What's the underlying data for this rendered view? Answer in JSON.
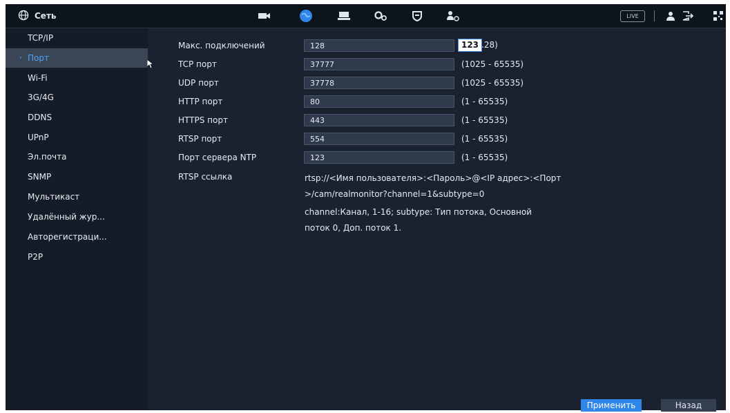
{
  "header": {
    "title": "Сеть",
    "live_label": "LIVE"
  },
  "sidebar": {
    "items": [
      {
        "label": "TCP/IP"
      },
      {
        "label": "Порт"
      },
      {
        "label": "Wi-Fi"
      },
      {
        "label": "3G/4G"
      },
      {
        "label": "DDNS"
      },
      {
        "label": "UPnP"
      },
      {
        "label": "Эл.почта"
      },
      {
        "label": "SNMP"
      },
      {
        "label": "Мультикаст"
      },
      {
        "label": "Удалённый жур..."
      },
      {
        "label": "Авторегистраци..."
      },
      {
        "label": "P2P"
      }
    ],
    "active_index": 1
  },
  "form": {
    "max_conn": {
      "label": "Макс. подключений",
      "value": "128",
      "tooltip_value": "123",
      "range_suffix": ".28)"
    },
    "tcp": {
      "label": "TCP порт",
      "value": "37777",
      "range": "(1025 - 65535)"
    },
    "udp": {
      "label": "UDP порт",
      "value": "37778",
      "range": "(1025 - 65535)"
    },
    "http": {
      "label": "HTTP порт",
      "value": "80",
      "range": "(1 - 65535)"
    },
    "https": {
      "label": "HTTPS порт",
      "value": "443",
      "range": "(1 - 65535)"
    },
    "rtsp": {
      "label": "RTSP порт",
      "value": "554",
      "range": "(1 - 65535)"
    },
    "ntp": {
      "label": "Порт сервера NTP",
      "value": "123",
      "range": "(1 - 65535)"
    },
    "rtsp_link": {
      "label": "RTSP ссылка",
      "line1": "rtsp://<Имя пользователя>:<Пароль>@<IP адрес>:<Порт",
      "line2": ">/cam/realmonitor?channel=1&subtype=0",
      "line3": "channel:Канал, 1-16; subtype: Тип потока, Основной",
      "line4": "поток 0, Доп. поток 1."
    }
  },
  "buttons": {
    "apply": "Применить",
    "back": "Назад"
  },
  "colors": {
    "accent": "#2f86e8",
    "active_text": "#4aa3ff",
    "background": "#1a2230",
    "sidebar": "#151c27"
  }
}
